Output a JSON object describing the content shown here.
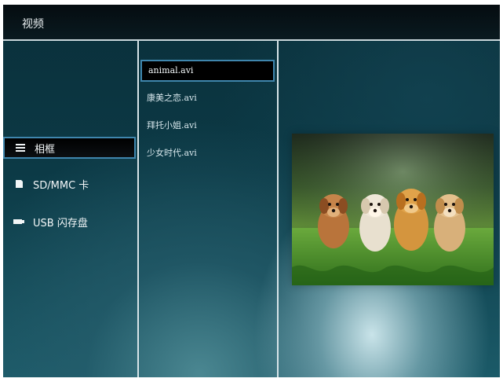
{
  "window": {
    "title": "视频"
  },
  "left_nav": {
    "items": [
      {
        "label": "相框",
        "icon": "list-icon",
        "selected": true
      },
      {
        "label": "SD/MMC 卡",
        "icon": "card-icon",
        "selected": false
      },
      {
        "label": "USB 闪存盘",
        "icon": "usb-icon",
        "selected": false
      }
    ]
  },
  "file_list": {
    "items": [
      {
        "label": "animal.avi",
        "selected": true
      },
      {
        "label": "康美之恋.avi",
        "selected": false
      },
      {
        "label": "拜托小姐.avi",
        "selected": false
      },
      {
        "label": "少女时代.avi",
        "selected": false
      }
    ]
  },
  "preview": {
    "icon": "video-thumbnail-puppies"
  },
  "colors": {
    "accent_border": "#3f86ad",
    "topbar": "#050c10",
    "divider": "#d7e4e8"
  }
}
